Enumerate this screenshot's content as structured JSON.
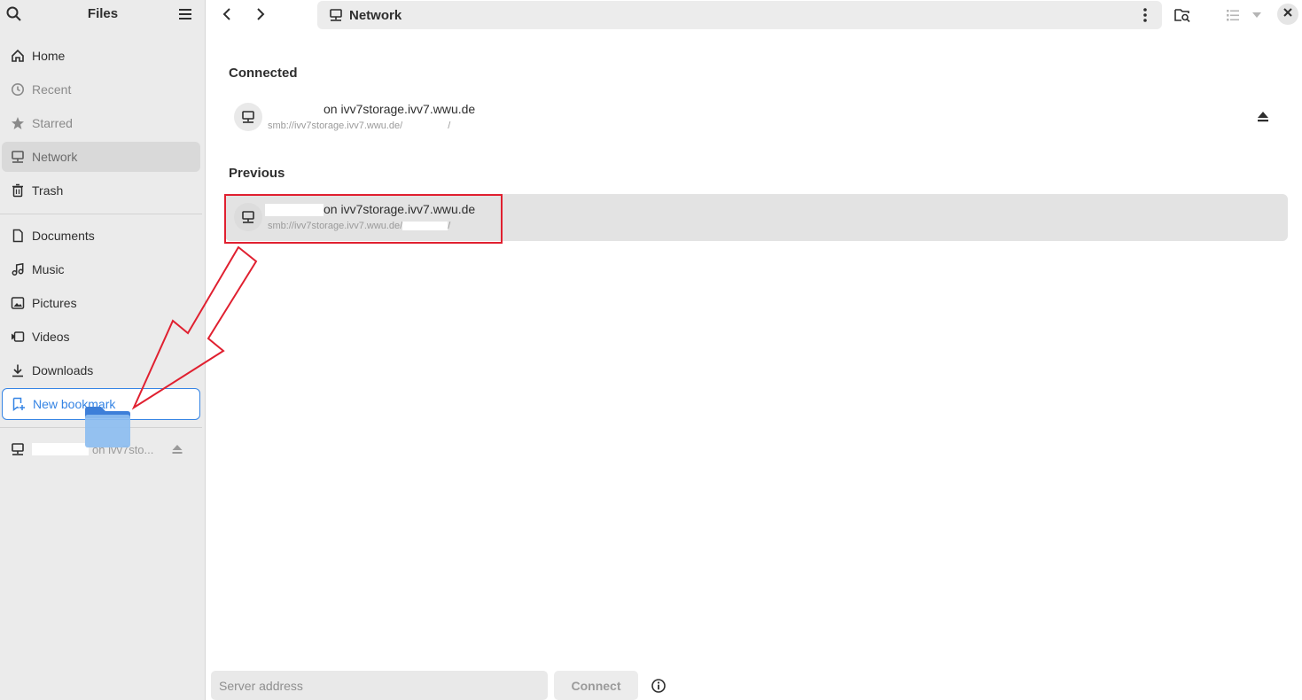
{
  "sidebar": {
    "title": "Files",
    "places": [
      {
        "label": "Home",
        "icon": "home-icon"
      },
      {
        "label": "Recent",
        "icon": "clock-icon"
      },
      {
        "label": "Starred",
        "icon": "star-icon"
      },
      {
        "label": "Network",
        "icon": "network-icon"
      },
      {
        "label": "Trash",
        "icon": "trash-icon"
      }
    ],
    "bookmarks": [
      {
        "label": "Documents",
        "icon": "document-icon"
      },
      {
        "label": "Music",
        "icon": "music-icon"
      },
      {
        "label": "Pictures",
        "icon": "picture-icon"
      },
      {
        "label": "Videos",
        "icon": "video-icon"
      },
      {
        "label": "Downloads",
        "icon": "download-icon"
      }
    ],
    "new_bookmark_label": "New bookmark",
    "mount_label": "on ivv7sto..."
  },
  "toolbar": {
    "location": "Network"
  },
  "main": {
    "connected_heading": "Connected",
    "previous_heading": "Previous",
    "connected": [
      {
        "title": "on ivv7storage.ivv7.wwu.de",
        "subtitle": "smb://ivv7storage.ivv7.wwu.de/",
        "subtitle_end": "/"
      }
    ],
    "previous": [
      {
        "title": "on ivv7storage.ivv7.wwu.de",
        "subtitle": "smb://ivv7storage.ivv7.wwu.de/",
        "subtitle_end": "/"
      }
    ]
  },
  "bottom": {
    "server_placeholder": "Server address",
    "connect_label": "Connect"
  },
  "colors": {
    "accent": "#3584e4",
    "annotation": "#e02030"
  }
}
